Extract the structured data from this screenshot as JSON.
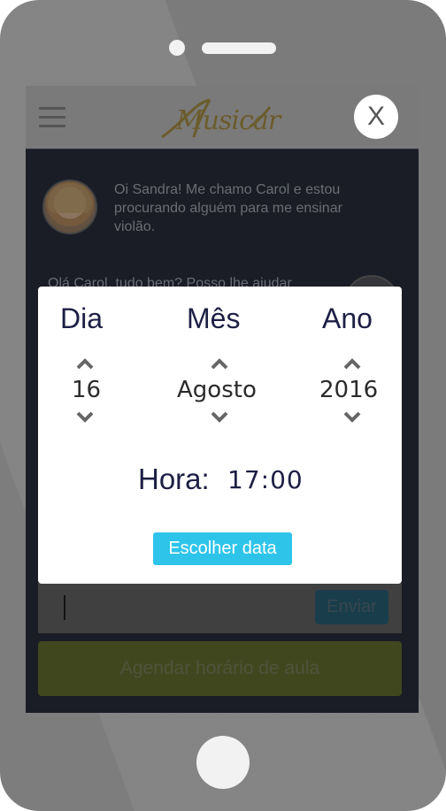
{
  "app": {
    "logo_text": "Musicar",
    "close_label": "X"
  },
  "chat": {
    "messages": [
      {
        "sender": "Carol",
        "text": "Oi Sandra! Me chamo Carol e estou procurando alguém para me ensinar violão."
      },
      {
        "sender": "Sandra",
        "text": "Olá Carol, tudo bem? Posso lhe ajudar"
      }
    ],
    "send_label": "Enviar",
    "schedule_label": "Agendar horário de aula"
  },
  "date_picker": {
    "day_label": "Dia",
    "month_label": "Mês",
    "year_label": "Ano",
    "day_value": "16",
    "month_value": "Agosto",
    "year_value": "2016",
    "hour_label": "Hora:",
    "hour_value": "17:00",
    "choose_label": "Escolher data"
  },
  "colors": {
    "screen_bg": "#2d3241",
    "header_bg": "#7a7a7a",
    "choose_button": "#2ec4ea",
    "send_button": "#2e6a82",
    "schedule_button": "#6f7a36",
    "picker_text": "#1d1f44"
  }
}
